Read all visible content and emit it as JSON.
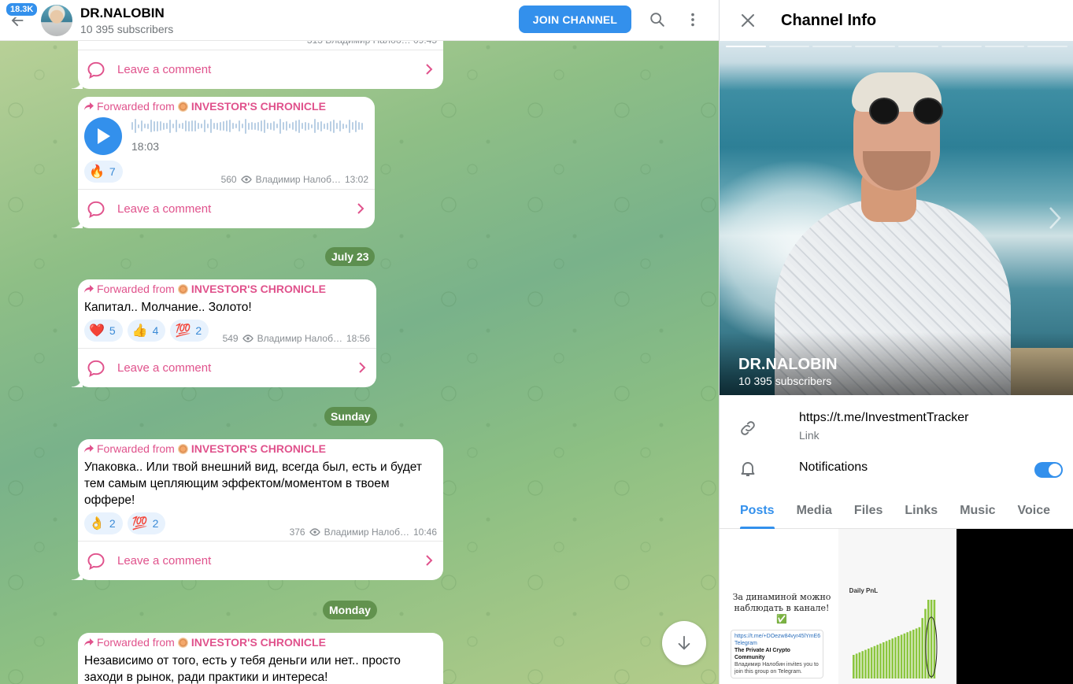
{
  "header": {
    "unread_badge": "18.3K",
    "title": "DR.NALOBIN",
    "subtitle": "10 395 subscribers",
    "join_label": "JOIN CHANNEL"
  },
  "messages": {
    "comment_label": "Leave a comment",
    "fwd_prefix": "Forwarded from",
    "fwd_channel": "INVESTOR'S CHRONICLE",
    "top_partial": {
      "meta": "313  Владимир Налоб…  09:45"
    },
    "voice": {
      "duration": "18:03",
      "reaction_emoji": "🔥",
      "reaction_count": "7",
      "views": "560",
      "author": "Владимир Налоб…",
      "time": "13:02"
    },
    "m2": {
      "text": "Капитал.. Молчание.. Золото!",
      "reactions": [
        {
          "emoji": "❤️",
          "count": "5"
        },
        {
          "emoji": "👍",
          "count": "4"
        },
        {
          "emoji": "💯",
          "count": "2"
        }
      ],
      "views": "549",
      "author": "Владимир Налоб…",
      "time": "18:56"
    },
    "m3": {
      "text": "Упаковка.. Или твой внешний вид, всегда был, есть и будет тем самым цепляющим эффектом/моментом в твоем оффере!",
      "reactions": [
        {
          "emoji": "👌",
          "count": "2"
        },
        {
          "emoji": "💯",
          "count": "2"
        }
      ],
      "views": "376",
      "author": "Владимир Налоб…",
      "time": "10:46"
    },
    "m4": {
      "text": "Независимо от того, есть у тебя деньги или нет.. просто заходи в рынок, ради практики и интереса!"
    }
  },
  "dates": {
    "d1": "July 23",
    "d2": "Sunday",
    "d3": "Monday"
  },
  "info": {
    "title": "Channel Info",
    "photo_name": "DR.NALOBIN",
    "photo_subs": "10 395 subscribers",
    "link": "https://t.me/InvestmentTracker",
    "link_label": "Link",
    "notifications_label": "Notifications",
    "notifications_on": true,
    "tabs": [
      "Posts",
      "Media",
      "Files",
      "Links",
      "Music",
      "Voice"
    ],
    "active_tab": "Posts",
    "media": {
      "post1_text": "За динаминой можно наблюдать в канале!✅",
      "post1_link": "https://t.me/+DOezw84vyr45lYmE6",
      "post1_card_title": "Telegram",
      "post1_card_name": "The Private AI Crypto Community",
      "post1_card_sub": "Владимир Налобин invites you to join this group on Telegram.",
      "post2_label": "Daily PnL"
    }
  },
  "colors": {
    "accent": "#3390ec",
    "forward": "#e0528c",
    "date_pill": "#5a8f45"
  }
}
